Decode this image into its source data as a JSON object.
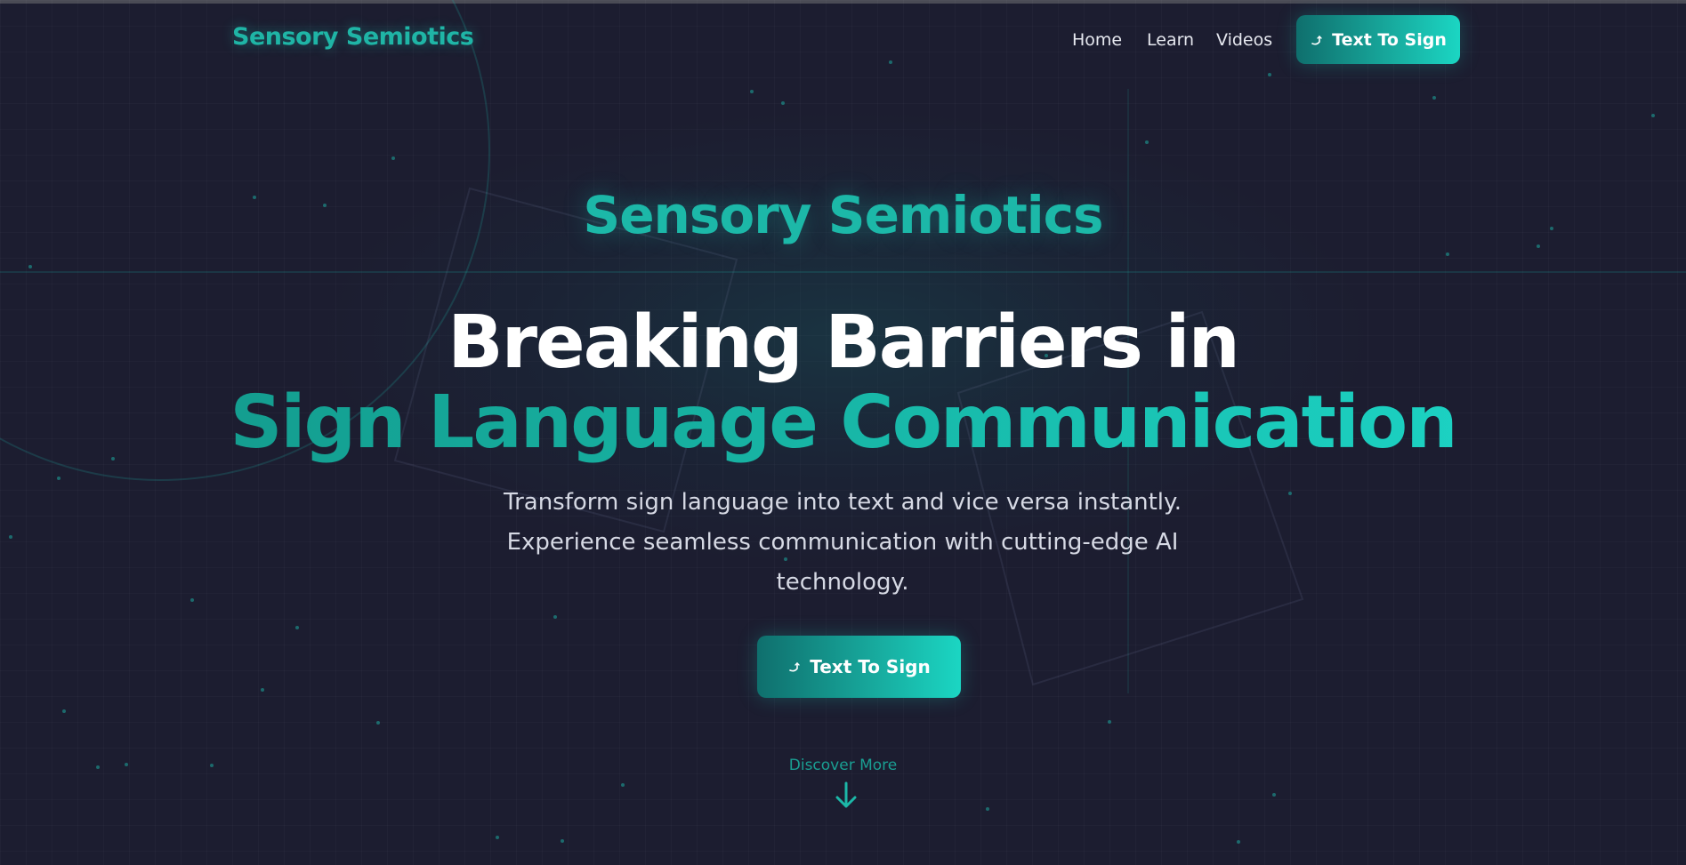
{
  "navbar": {
    "brand": "Sensory Semiotics",
    "links": [
      "Home",
      "Learn",
      "Videos"
    ],
    "cta_label": "Text To Sign"
  },
  "hero": {
    "brand": "Sensory Semiotics",
    "headline_line1": "Breaking Barriers in",
    "headline_line2": "Sign Language Communication",
    "subtitle": "Transform sign language into text and vice versa instantly. Experience seamless communication with cutting-edge AI technology.",
    "cta_label": "Text To Sign",
    "discover_label": "Discover More"
  },
  "icons": {
    "cta_icon": "hand-icon",
    "scroll_icon": "arrow-down-icon"
  },
  "colors": {
    "background": "#1c1d30",
    "accent": "#1cb8a8",
    "accent_bright": "#1ddbcc",
    "text": "#ffffff",
    "muted_text": "#d6d9e4"
  }
}
